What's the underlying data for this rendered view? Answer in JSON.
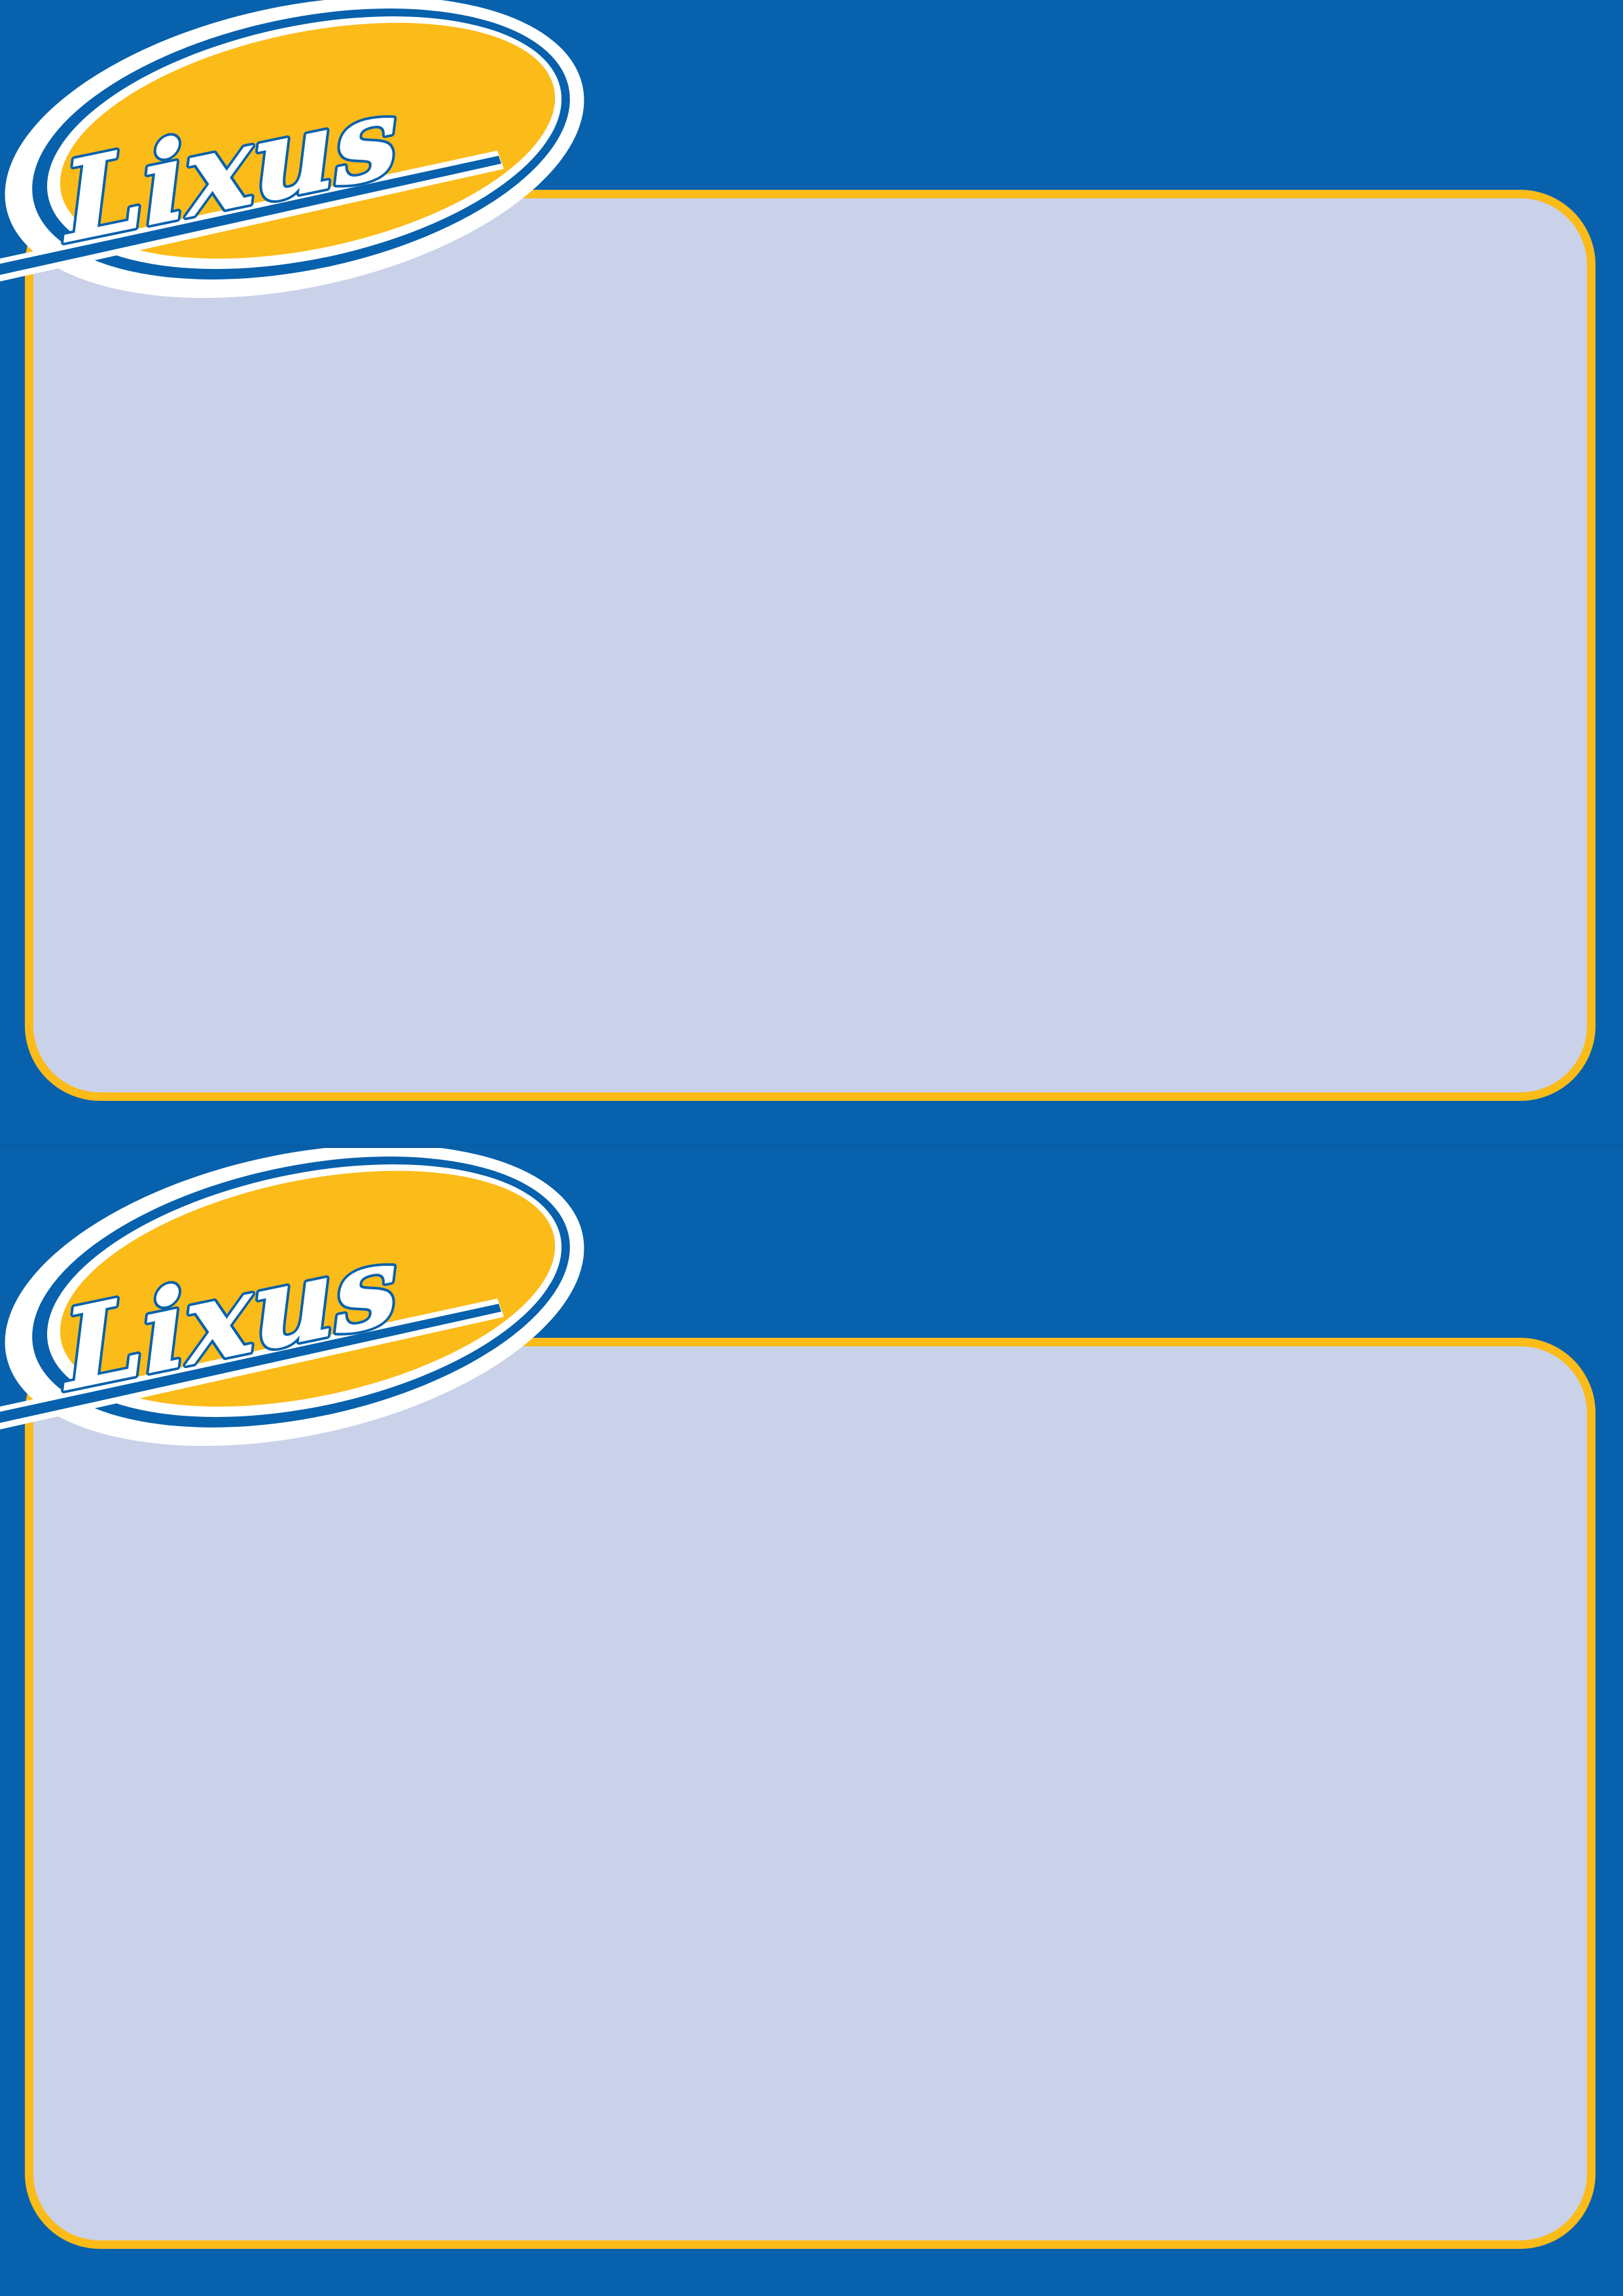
{
  "colors": {
    "background": "#0761ac",
    "panel_fill": "#cad2ea",
    "panel_border": "#fbbb19",
    "logo_yellow": "#fbbb19",
    "logo_blue": "#0761ac",
    "logo_white": "#ffffff"
  },
  "cards": [
    {
      "logo": {
        "wordmark": "Lixus",
        "icon": "lixus-logo"
      }
    },
    {
      "logo": {
        "wordmark": "Lixus",
        "icon": "lixus-logo"
      }
    }
  ]
}
